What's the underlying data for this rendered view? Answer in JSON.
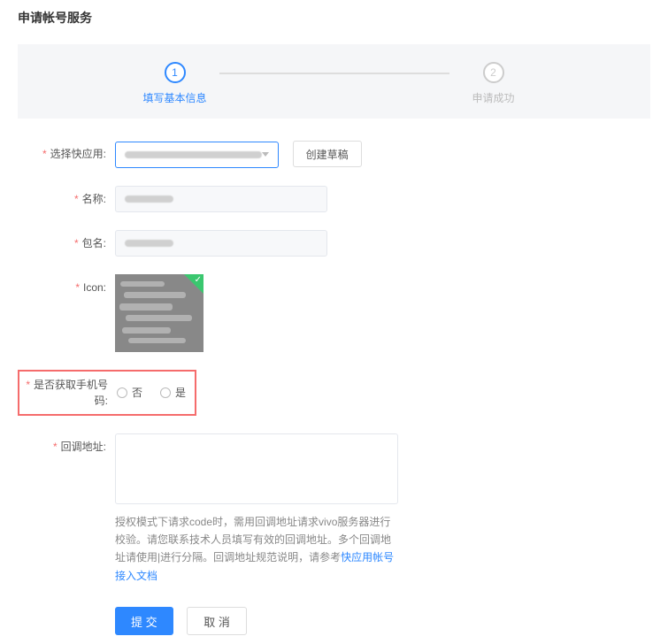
{
  "pageTitle": "申请帐号服务",
  "steps": {
    "s1": "填写基本信息",
    "s2": "申请成功",
    "n1": "1",
    "n2": "2"
  },
  "labels": {
    "selectApp": "选择快应用:",
    "createDraft": "创建草稿",
    "name": "名称:",
    "pkg": "包名:",
    "icon": "Icon:",
    "getPhone": "是否获取手机号码:",
    "callback": "回调地址:"
  },
  "radios": {
    "no": "否",
    "yes": "是"
  },
  "helper": {
    "text1": "授权模式下请求code时，需用回调地址请求vivo服务器进行校验。请您联系技术人员填写有效的回调地址。多个回调地址请使用|进行分隔。回调地址规范说明，请参考",
    "link": "快应用帐号接入文档"
  },
  "buttons": {
    "submit": "提 交",
    "cancel": "取 消"
  }
}
